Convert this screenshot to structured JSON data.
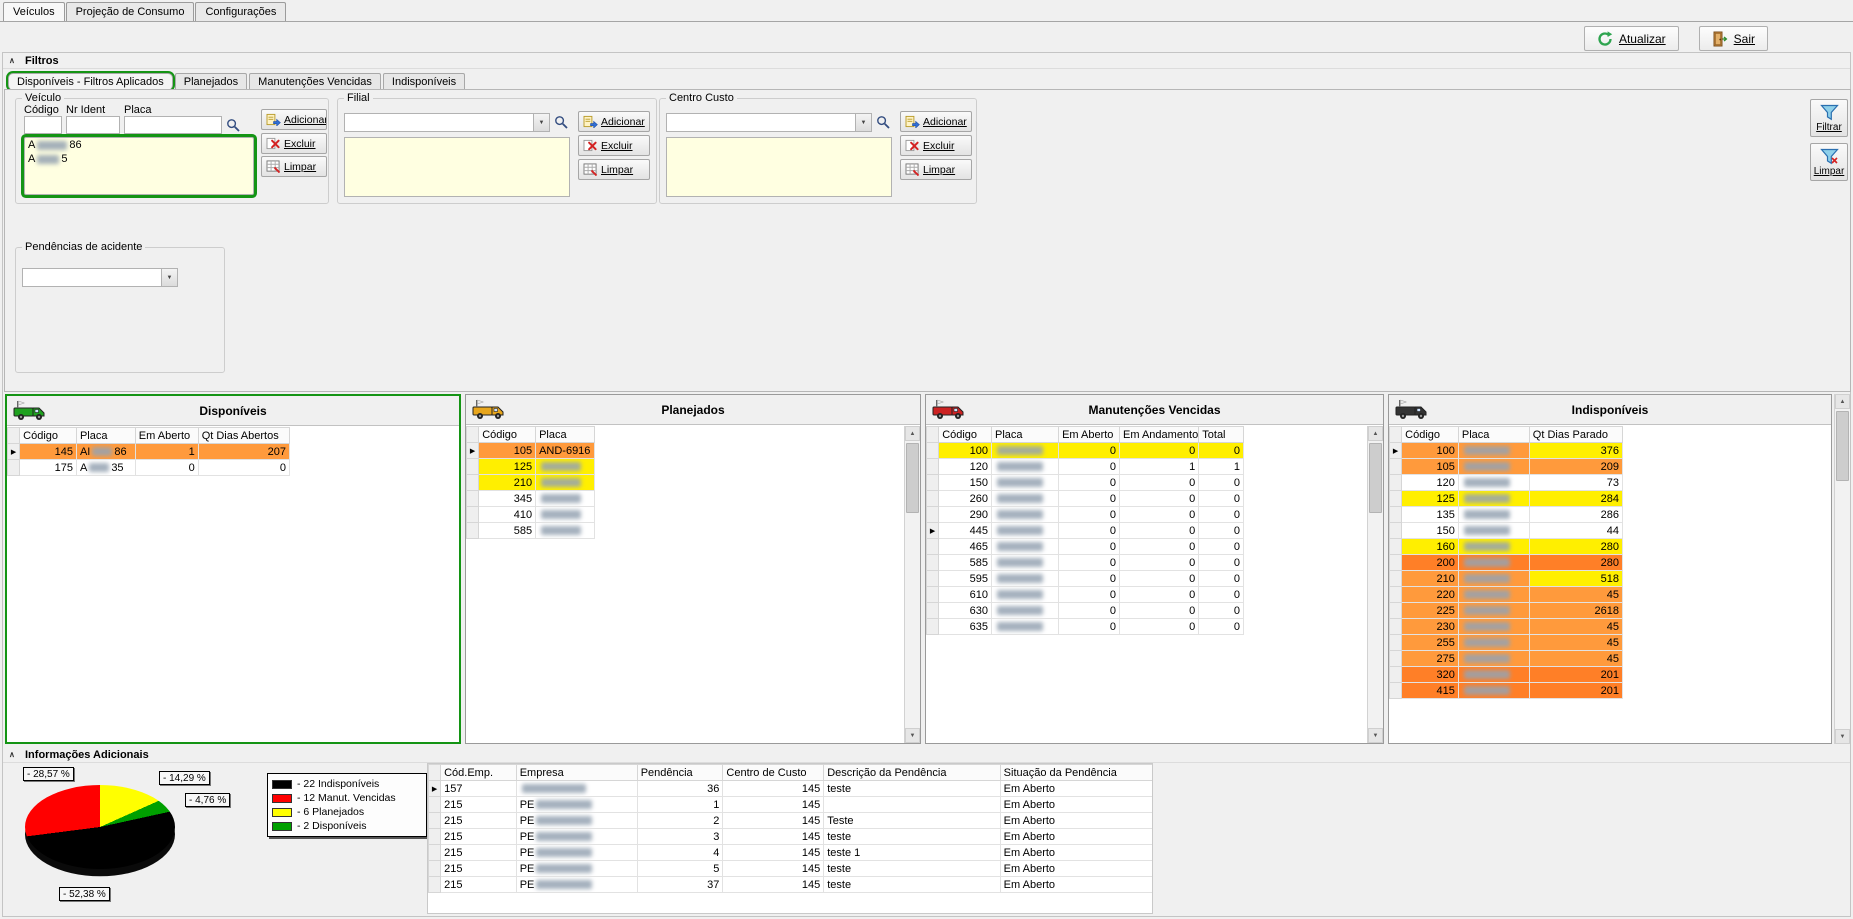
{
  "window": {
    "tabs": [
      "Veículos",
      "Projeção de Consumo",
      "Configurações"
    ],
    "active_tab": "Veículos",
    "toolbar": {
      "atualizar": "Atualizar",
      "sair": "Sair"
    }
  },
  "filtros": {
    "header": "Filtros",
    "tabs": [
      "Disponíveis - Filtros Aplicados",
      "Planejados",
      "Manutenções Vencidas",
      "Indisponíveis"
    ],
    "active_tab": "Disponíveis - Filtros Aplicados",
    "veiculo": {
      "title": "Veículo",
      "labels": {
        "codigo": "Código",
        "nr_ident": "Nr Ident",
        "placa": "Placa"
      },
      "inputs": {
        "codigo": "",
        "nr_ident": "",
        "placa": ""
      },
      "buttons": {
        "adicionar": "Adicionar",
        "excluir": "Excluir",
        "limpar": "Limpar"
      },
      "items": [
        {
          "pre": "A",
          "blur": 30,
          "post": "86"
        },
        {
          "pre": "A",
          "blur": 22,
          "post": "5"
        }
      ]
    },
    "filial": {
      "title": "Filial",
      "value": "",
      "buttons": {
        "adicionar": "Adicionar",
        "excluir": "Excluir",
        "limpar": "Limpar"
      }
    },
    "centro_custo": {
      "title": "Centro Custo",
      "value": "",
      "buttons": {
        "adicionar": "Adicionar",
        "excluir": "Excluir",
        "limpar": "Limpar"
      }
    },
    "side_buttons": {
      "filtrar": "Filtrar",
      "limpar": "Limpar"
    },
    "pendencias": {
      "title": "Pendências de acidente",
      "value": ""
    }
  },
  "panels": [
    {
      "title": "Disponíveis",
      "truck_color": "#1fa11f",
      "annotated": true,
      "vscroll": false,
      "columns": [
        "Código",
        "Placa",
        "Em Aberto",
        "Qt Dias Abertos"
      ],
      "widths": [
        56,
        58,
        62,
        90
      ],
      "aligns": [
        "r",
        "l",
        "r",
        "r"
      ],
      "rows": [
        {
          "arrow": true,
          "bg": "orange",
          "cells": [
            "145",
            {
              "pre": "AI",
              "blur": 20,
              "post": "86"
            },
            "1",
            "207"
          ]
        },
        {
          "cells": [
            "175",
            {
              "pre": "A",
              "blur": 20,
              "post": "35"
            },
            "0",
            "0"
          ]
        }
      ]
    },
    {
      "title": "Planejados",
      "truck_color": "#e8a61c",
      "annotated": false,
      "vscroll": true,
      "columns": [
        "Código",
        "Placa"
      ],
      "widths": [
        56,
        58
      ],
      "aligns": [
        "r",
        "l"
      ],
      "rows": [
        {
          "arrow": true,
          "bg": "orange",
          "cells": [
            "105",
            "AND-6916"
          ]
        },
        {
          "bg": "yellow",
          "cells": [
            "125",
            {
              "blur": 40
            }
          ]
        },
        {
          "bg": "yellow",
          "cells": [
            "210",
            {
              "blur": 40
            }
          ]
        },
        {
          "cells": [
            "345",
            {
              "blur": 40
            }
          ]
        },
        {
          "cells": [
            "410",
            {
              "blur": 40
            }
          ]
        },
        {
          "cells": [
            "585",
            {
              "blur": 40
            }
          ]
        }
      ]
    },
    {
      "title": "Manutenções Vencidas",
      "truck_color": "#cc2222",
      "annotated": false,
      "vscroll": true,
      "columns": [
        "Código",
        "Placa",
        "Em Aberto",
        "Em Andamento",
        "Total"
      ],
      "widths": [
        52,
        66,
        60,
        78,
        44
      ],
      "aligns": [
        "r",
        "l",
        "r",
        "r",
        "r"
      ],
      "rows": [
        {
          "bg": "yellow",
          "cells": [
            "100",
            {
              "blur": 46
            },
            "0",
            "0",
            "0"
          ]
        },
        {
          "cells": [
            "120",
            {
              "blur": 46
            },
            "0",
            "1",
            "1"
          ]
        },
        {
          "cells": [
            "150",
            {
              "blur": 46
            },
            "0",
            "0",
            "0"
          ]
        },
        {
          "cells": [
            "260",
            {
              "blur": 46
            },
            "0",
            "0",
            "0"
          ]
        },
        {
          "cells": [
            "290",
            {
              "blur": 46
            },
            "0",
            "0",
            "0"
          ]
        },
        {
          "arrow": true,
          "cells": [
            "445",
            {
              "blur": 46
            },
            "0",
            "0",
            "0"
          ]
        },
        {
          "cells": [
            "465",
            {
              "blur": 46
            },
            "0",
            "0",
            "0"
          ]
        },
        {
          "cells": [
            "585",
            {
              "blur": 46
            },
            "0",
            "0",
            "0"
          ]
        },
        {
          "cells": [
            "595",
            {
              "blur": 46
            },
            "0",
            "0",
            "0"
          ]
        },
        {
          "cells": [
            "610",
            {
              "blur": 46
            },
            "0",
            "0",
            "0"
          ]
        },
        {
          "cells": [
            "630",
            {
              "blur": 46
            },
            "0",
            "0",
            "0"
          ]
        },
        {
          "cells": [
            "635",
            {
              "blur": 46
            },
            "0",
            "0",
            "0"
          ]
        }
      ]
    },
    {
      "title": "Indisponíveis",
      "truck_color": "#333333",
      "annotated": false,
      "vscroll": false,
      "columns": [
        "Código",
        "Placa",
        "Qt Dias Parado"
      ],
      "widths": [
        56,
        70,
        92
      ],
      "aligns": [
        "r",
        "l",
        "r"
      ],
      "rows": [
        {
          "arrow": true,
          "bg": "orange",
          "cells": [
            "100",
            {
              "blur": 46
            },
            {
              "t": "376",
              "bg": "yellow"
            }
          ]
        },
        {
          "bg": "orange",
          "cells": [
            "105",
            {
              "blur": 46
            },
            "209"
          ]
        },
        {
          "cells": [
            "120",
            {
              "blur": 46
            },
            "73"
          ]
        },
        {
          "bg": "yellow",
          "cells": [
            "125",
            {
              "blur": 46
            },
            "284"
          ]
        },
        {
          "cells": [
            "135",
            {
              "blur": 46
            },
            "286"
          ]
        },
        {
          "cells": [
            "150",
            {
              "blur": 46
            },
            "44"
          ]
        },
        {
          "bg": "yellow",
          "cells": [
            "160",
            {
              "blur": 46
            },
            "280"
          ]
        },
        {
          "bg": "orange2",
          "cells": [
            "200",
            {
              "blur": 46
            },
            "280"
          ]
        },
        {
          "bg": "orange",
          "cells": [
            "210",
            {
              "blur": 46
            },
            {
              "t": "518",
              "bg": "yellow"
            }
          ]
        },
        {
          "bg": "orange",
          "cells": [
            "220",
            {
              "blur": 46
            },
            "45"
          ]
        },
        {
          "bg": "orange",
          "cells": [
            "225",
            {
              "blur": 46
            },
            "2618"
          ]
        },
        {
          "bg": "orange",
          "cells": [
            "230",
            {
              "blur": 46
            },
            "45"
          ]
        },
        {
          "bg": "orange",
          "cells": [
            "255",
            {
              "blur": 46
            },
            "45"
          ]
        },
        {
          "bg": "orange",
          "cells": [
            "275",
            {
              "blur": 46
            },
            "45"
          ]
        },
        {
          "bg": "orange2",
          "cells": [
            "320",
            {
              "blur": 46
            },
            "201"
          ]
        },
        {
          "bg": "orange2",
          "cells": [
            "415",
            {
              "blur": 46
            },
            "201"
          ]
        }
      ]
    }
  ],
  "info": {
    "header": "Informações Adicionais",
    "pie_labels": [
      "- 28,57 %",
      "- 14,29 %",
      "- 4,76 %",
      "- 52,38 %"
    ],
    "legend": [
      {
        "color": "#000000",
        "label": "- 22 Indisponíveis"
      },
      {
        "color": "#ff0000",
        "label": "- 12 Manut. Vencidas"
      },
      {
        "color": "#ffff00",
        "label": "- 6 Planejados"
      },
      {
        "color": "#00a000",
        "label": "- 2 Disponíveis"
      }
    ],
    "table": {
      "columns": [
        "Cód.Emp.",
        "Empresa",
        "Pendência",
        "Centro de Custo",
        "Descrição da Pendência",
        "Situação da Pendência"
      ],
      "widths": [
        75,
        120,
        85,
        100,
        175,
        155
      ],
      "aligns": [
        "l",
        "l",
        "r",
        "r",
        "l",
        "l"
      ],
      "rows": [
        {
          "arrow": true,
          "cells": [
            "157",
            {
              "blur": 64
            },
            "36",
            "145",
            "teste",
            "Em Aberto"
          ]
        },
        {
          "cells": [
            "215",
            {
              "pre": "PE",
              "blur": 56
            },
            "1",
            "145",
            "",
            "Em Aberto"
          ]
        },
        {
          "cells": [
            "215",
            {
              "pre": "PE",
              "blur": 56
            },
            "2",
            "145",
            "Teste",
            "Em Aberto"
          ]
        },
        {
          "cells": [
            "215",
            {
              "pre": "PE",
              "blur": 56
            },
            "3",
            "145",
            "teste",
            "Em Aberto"
          ]
        },
        {
          "cells": [
            "215",
            {
              "pre": "PE",
              "blur": 56
            },
            "4",
            "145",
            "teste 1",
            "Em Aberto"
          ]
        },
        {
          "cells": [
            "215",
            {
              "pre": "PE",
              "blur": 56
            },
            "5",
            "145",
            "teste",
            "Em Aberto"
          ]
        },
        {
          "cells": [
            "215",
            {
              "pre": "PE",
              "blur": 56
            },
            "37",
            "145",
            "teste",
            "Em Aberto"
          ]
        }
      ]
    }
  },
  "chart_data": {
    "type": "pie",
    "labels": [
      "Indisponíveis",
      "Manut. Vencidas",
      "Planejados",
      "Disponíveis"
    ],
    "values": [
      22,
      12,
      6,
      2
    ],
    "percentages": [
      52.38,
      28.57,
      14.29,
      4.76
    ],
    "percent_labels": [
      "- 52,38 %",
      "- 28,57 %",
      "- 14,29 %",
      "- 4,76 %"
    ],
    "colors": [
      "#000000",
      "#ff0000",
      "#ffff00",
      "#00a000"
    ],
    "legend_entries": [
      "- 22 Indisponíveis",
      "- 12 Manut. Vencidas",
      "- 6 Planejados",
      "- 2 Disponíveis"
    ],
    "legend_position": "right",
    "style": "3d"
  },
  "colors": {
    "row_orange": "#ff9a3c",
    "row_orange_deep": "#ff7f27",
    "row_yellow": "#ffef00",
    "annotation_green": "#149414",
    "list_background": "#ffffe1"
  }
}
